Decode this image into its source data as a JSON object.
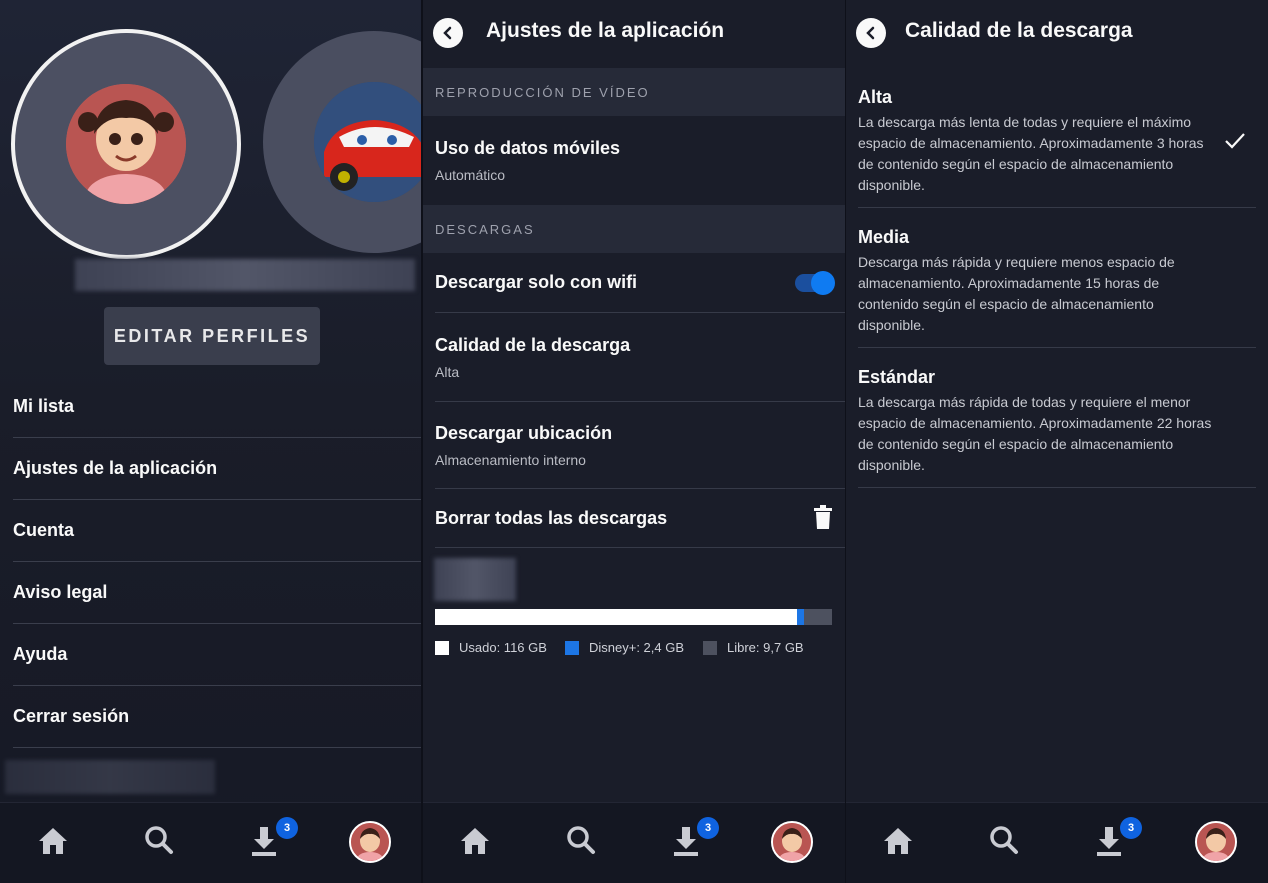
{
  "profiles_screen": {
    "edit_profiles_label": "EDITAR PERFILES",
    "menu": [
      {
        "label": "Mi lista"
      },
      {
        "label": "Ajustes de la aplicación"
      },
      {
        "label": "Cuenta"
      },
      {
        "label": "Aviso legal"
      },
      {
        "label": "Ayuda"
      },
      {
        "label": "Cerrar sesión"
      }
    ]
  },
  "settings_screen": {
    "title": "Ajustes de la aplicación",
    "section_video": "REPRODUCCIÓN DE VÍDEO",
    "mobile_data": {
      "title": "Uso de datos móviles",
      "value": "Automático"
    },
    "section_downloads": "DESCARGAS",
    "wifi_only": {
      "title": "Descargar solo con wifi",
      "enabled": true
    },
    "download_quality": {
      "title": "Calidad de la descarga",
      "value": "Alta"
    },
    "download_location": {
      "title": "Descargar ubicación",
      "value": "Almacenamiento interno"
    },
    "delete_all": {
      "title": "Borrar todas las descargas"
    },
    "storage": {
      "used_fraction": 0.911,
      "disney_fraction": 0.019,
      "legend_used": "Usado: 116 GB",
      "legend_disney": "Disney+: 2,4 GB",
      "legend_free": "Libre: 9,7 GB"
    }
  },
  "quality_screen": {
    "title": "Calidad de la descarga",
    "options": [
      {
        "title": "Alta",
        "desc": "La descarga más lenta de todas y requiere el máximo espacio de almacenamiento. Aproximadamente 3 horas de contenido según el espacio de almacenamiento disponible.",
        "selected": true
      },
      {
        "title": "Media",
        "desc": "Descarga más rápida y requiere menos espacio de almacenamiento. Aproximadamente 15 horas de contenido según el espacio de almacenamiento disponible.",
        "selected": false
      },
      {
        "title": "Estándar",
        "desc": "La descarga más rápida de todas y requiere el menor espacio de almacenamiento. Aproximadamente 22 horas de contenido según el espacio de almacenamiento disponible.",
        "selected": false
      }
    ]
  },
  "bottom_nav": {
    "downloads_badge": "3"
  },
  "colors": {
    "accent": "#0f7bf2",
    "background": "#1a1d29",
    "badge": "#0f63e0"
  }
}
